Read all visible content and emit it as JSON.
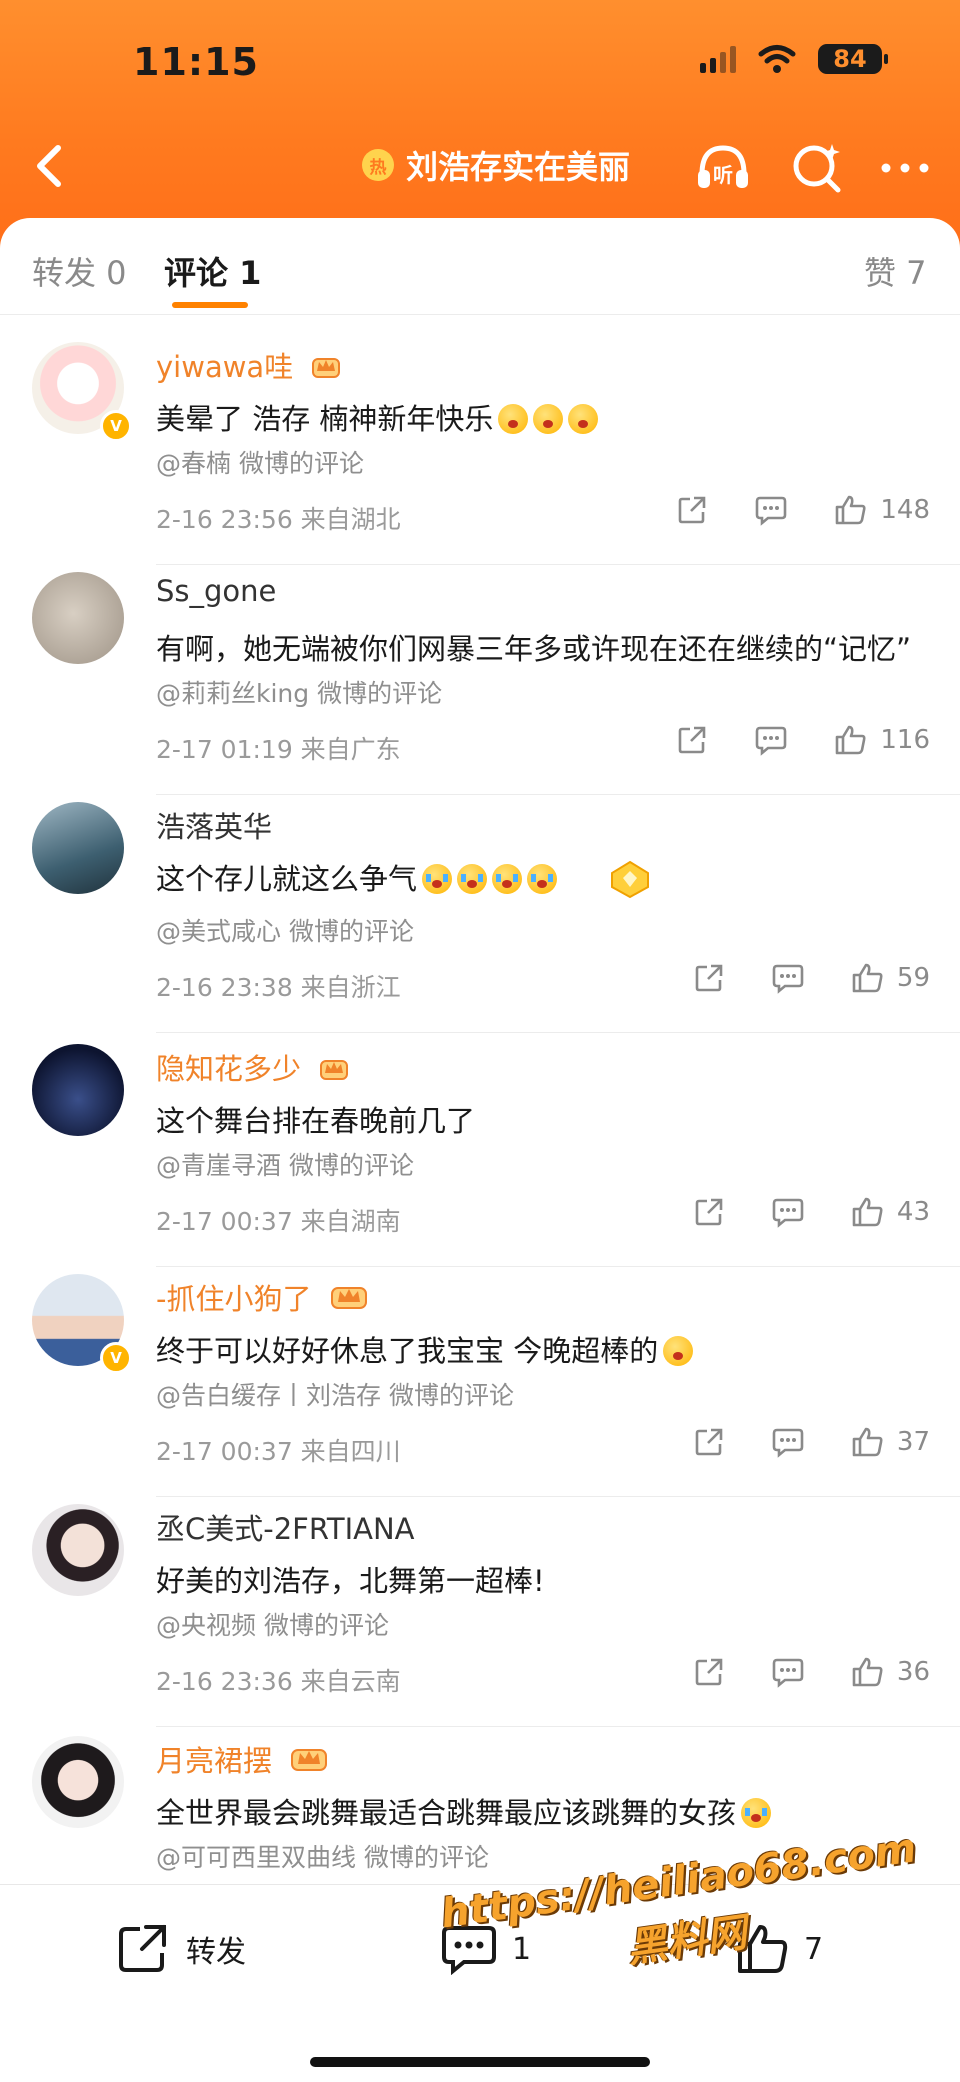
{
  "status_bar": {
    "time": "11:15",
    "battery": "84"
  },
  "nav": {
    "topic_badge": "热",
    "topic_title": "刘浩存实在美丽",
    "listen_label": "听"
  },
  "tabs": {
    "repost": "转发 0",
    "comment": "评论 1",
    "like": "赞 7"
  },
  "comments": [
    {
      "username": "yiwawa哇",
      "text": "美晕了 浩存 楠神新年快乐",
      "source": "@春楠 微博的评论",
      "meta": "2-16 23:56 来自湖北",
      "likes": "148"
    },
    {
      "username": "Ss_gone",
      "text": "有啊，她无端被你们网暴三年多或许现在还在继续的“记忆”",
      "source": "@莉莉丝king 微博的评论",
      "meta": "2-17 01:19 来自广东",
      "likes": "116"
    },
    {
      "username": "浩落英华",
      "text": "这个存儿就这么争气",
      "source": "@美式咸心 微博的评论",
      "meta": "2-16 23:38 来自浙江",
      "likes": "59"
    },
    {
      "username": "隐知花多少",
      "text": "这个舞台排在春晚前几了",
      "source": "@青崖寻酒 微博的评论",
      "meta": "2-17 00:37 来自湖南",
      "likes": "43"
    },
    {
      "username": "-抓住小狗了",
      "text": "终于可以好好休息了我宝宝 今晚超棒的",
      "source": "@告白缓存丨刘浩存 微博的评论",
      "meta": "2-17 00:37 来自四川",
      "likes": "37"
    },
    {
      "username": "丞C美式-2FRTIANA",
      "text": "好美的刘浩存，北舞第一超棒!",
      "source": "@央视频 微博的评论",
      "meta": "2-16 23:36 来自云南",
      "likes": "36"
    },
    {
      "username": "月亮裙摆",
      "text": "全世界最会跳舞最适合跳舞最应该跳舞的女孩",
      "source": "@可可西里双曲线 微博的评论",
      "meta": "",
      "likes": ""
    }
  ],
  "bottom_bar": {
    "repost_label": "转发",
    "comment_count": "1",
    "like_count": "7"
  },
  "watermark": {
    "url": "https://heiliao68.com",
    "name": "黑料网"
  },
  "colors": {
    "header_orange": "#ff7a1f",
    "vip_name": "#f0832a",
    "tab_accent": "#ff8200"
  }
}
